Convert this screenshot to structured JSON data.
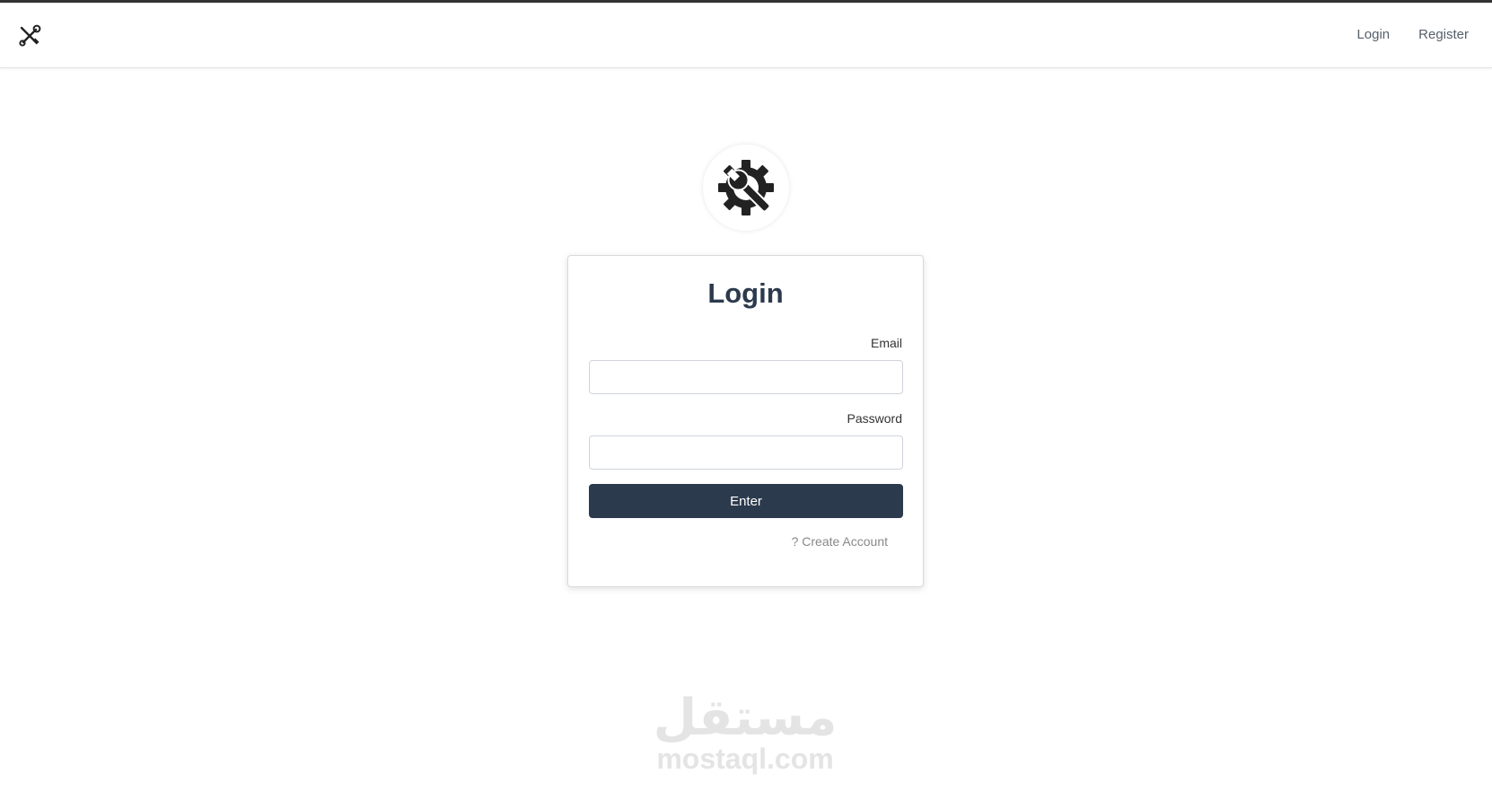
{
  "navbar": {
    "brand_icon": "tools-icon",
    "links": [
      {
        "label": "Login"
      },
      {
        "label": "Register"
      }
    ]
  },
  "logo": {
    "icon": "gear-wrench-icon",
    "color": "#222222"
  },
  "login_form": {
    "title": "Login",
    "email_label": "Email",
    "email_value": "",
    "password_label": "Password",
    "password_value": "",
    "submit_label": "Enter",
    "create_account_link": "? Create Account"
  },
  "watermark": {
    "arabic": "مستقل",
    "latin": "mostaql.com"
  },
  "colors": {
    "primary": "#2c3a4d",
    "link_muted": "#888888",
    "nav_text": "#555f6b"
  }
}
